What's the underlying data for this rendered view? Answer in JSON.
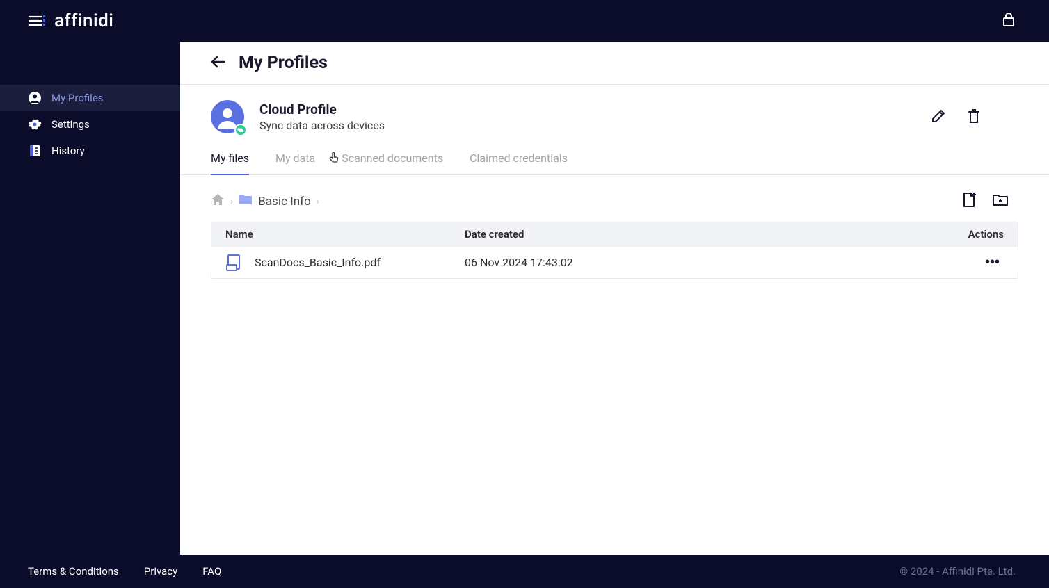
{
  "brand": {
    "name": "affinidi"
  },
  "sidebar": {
    "items": [
      {
        "label": "My Profiles"
      },
      {
        "label": "Settings"
      },
      {
        "label": "History"
      }
    ]
  },
  "page": {
    "title": "My Profiles"
  },
  "profile": {
    "title": "Cloud Profile",
    "subtitle": "Sync data across devices"
  },
  "tabs": [
    {
      "label": "My files"
    },
    {
      "label": "My data"
    },
    {
      "label": "Scanned documents"
    },
    {
      "label": "Claimed credentials"
    }
  ],
  "breadcrumb": {
    "current": "Basic Info"
  },
  "table": {
    "headers": {
      "name": "Name",
      "date": "Date created",
      "actions": "Actions"
    },
    "rows": [
      {
        "name": "ScanDocs_Basic_Info.pdf",
        "date": "06 Nov 2024 17:43:02"
      }
    ]
  },
  "footer": {
    "links": [
      {
        "label": "Terms & Conditions"
      },
      {
        "label": "Privacy"
      },
      {
        "label": "FAQ"
      }
    ],
    "copyright": "© 2024 - Affinidi Pte. Ltd."
  }
}
